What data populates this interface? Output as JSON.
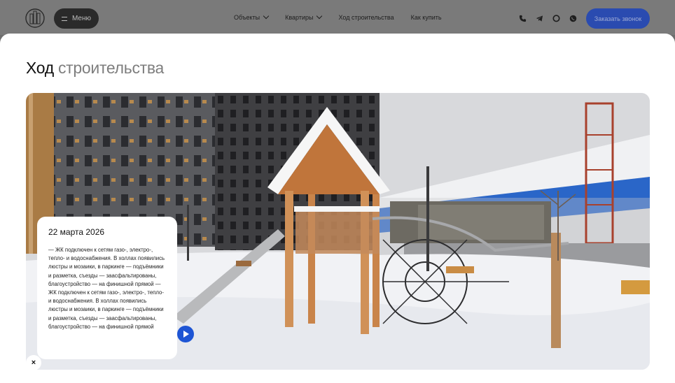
{
  "header": {
    "menu_label": "Меню",
    "nav": [
      {
        "label": "Объекты",
        "has_dropdown": true
      },
      {
        "label": "Квартиры",
        "has_dropdown": true
      },
      {
        "label": "Ход строительства",
        "has_dropdown": false
      },
      {
        "label": "Как купить",
        "has_dropdown": false
      }
    ],
    "social_icons": [
      "phone-icon",
      "telegram-icon",
      "chat-icon",
      "whatsapp-icon"
    ],
    "call_button_label": "Заказать звонок"
  },
  "modal": {
    "title_main": "Ход",
    "title_accent": "строительства",
    "card": {
      "date": "22 марта 2026",
      "text": "— ЖК подключен к сетям газо-, электро-, тепло- и водоснабжения. В холлах появились люстры и мозаики, в паркинге — подъёмники и разметка, съезды — заасфальтированы, благоустройство — на финишной прямой — ЖК подключен к сетям газо-, электро-, тепло- и водоснабжения. В холлах появились люстры и мозаики, в паркинге — подъёмники и разметка, съезды — заасфальтированы, благоустройство — на финишной прямой"
    },
    "close_label": "×"
  },
  "colors": {
    "accent": "#1e55d4",
    "call_button": "#2a4bb0",
    "menu_button": "#2a2a2a",
    "title_accent": "#7e7e7e"
  }
}
